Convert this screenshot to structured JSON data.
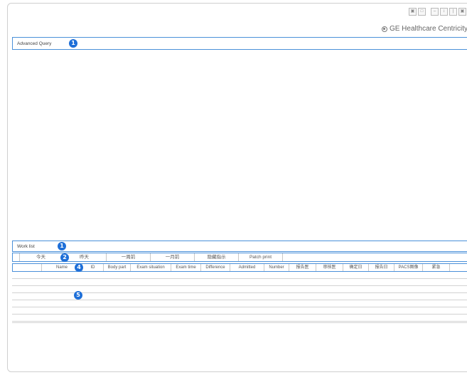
{
  "window": {
    "controls": [
      "▣",
      "□",
      "–",
      "↕",
      "|",
      "▣",
      "×"
    ]
  },
  "brand": {
    "name": "GE Healthcare Centricity",
    "mark": "™"
  },
  "advanced_query": {
    "title": "Advanced Query",
    "badge": "1"
  },
  "worklist": {
    "title": "Work list",
    "badge_title": "1",
    "badge_buttons": "2",
    "badge_header": "4",
    "badge_rows": "5",
    "buttons": [
      "今天",
      "昨天",
      "一周前",
      "一月前",
      "隐藏指示",
      "Patch print"
    ],
    "columns": [
      "",
      "Name",
      "ID",
      "Body part",
      "Exam situation",
      "Exam time",
      "Difference",
      "Admitted",
      "Number",
      "报告医",
      "审核医",
      "确定日",
      "报告日",
      "PACS图像",
      "紧急"
    ],
    "row_count": 7
  }
}
